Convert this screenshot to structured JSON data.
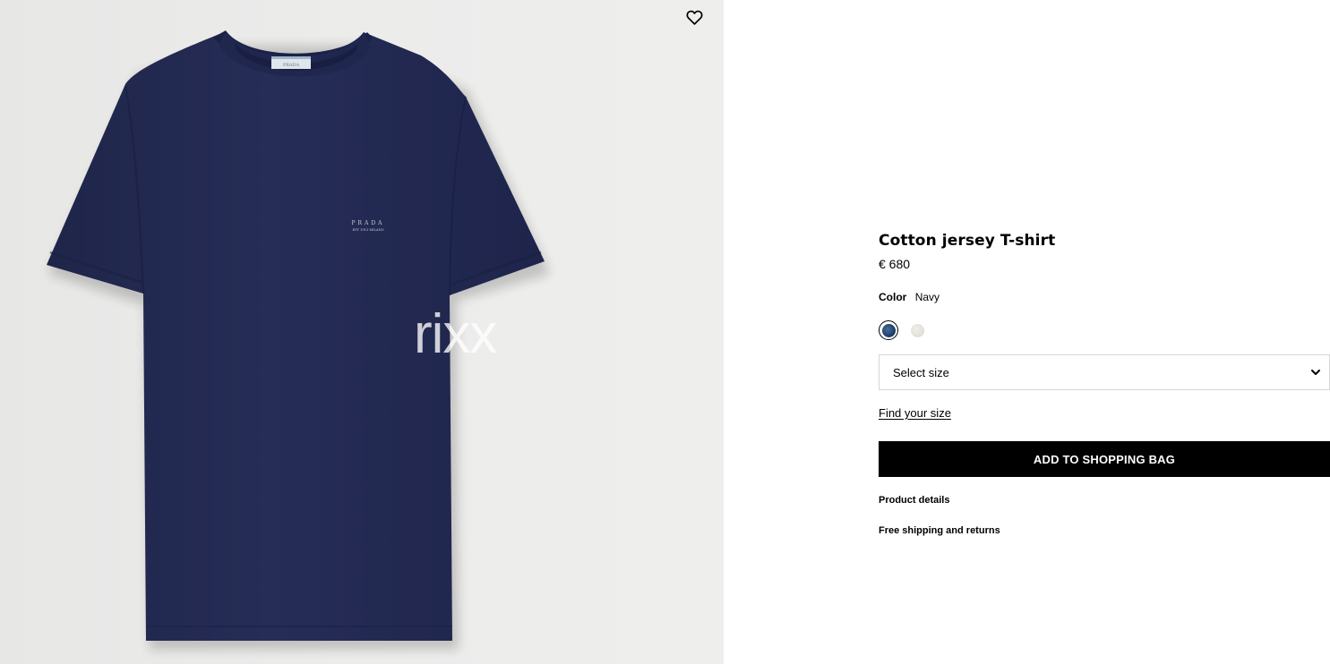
{
  "gallery": {
    "wishlist_icon": "heart-icon",
    "watermark": "rixx",
    "tag_text": "PRADA",
    "print_line1": "PRADA",
    "print_line2": "EST 1913 MILANO",
    "shirt_color": "#232a52"
  },
  "product": {
    "title": "Cotton jersey T-shirt",
    "price": "€ 680",
    "color_label": "Color",
    "color_value": "Navy",
    "swatches": [
      {
        "name": "Navy",
        "color": "#1f3f6b",
        "selected": true
      },
      {
        "name": "Ecru",
        "color": "#e4e0d9",
        "selected": false
      }
    ],
    "size_placeholder": "Select size",
    "size_icon": "chevron-down-icon",
    "find_size": "Find your size",
    "add_to_bag": "ADD TO SHOPPING BAG",
    "details_link": "Product details",
    "shipping_link": "Free shipping and returns"
  }
}
